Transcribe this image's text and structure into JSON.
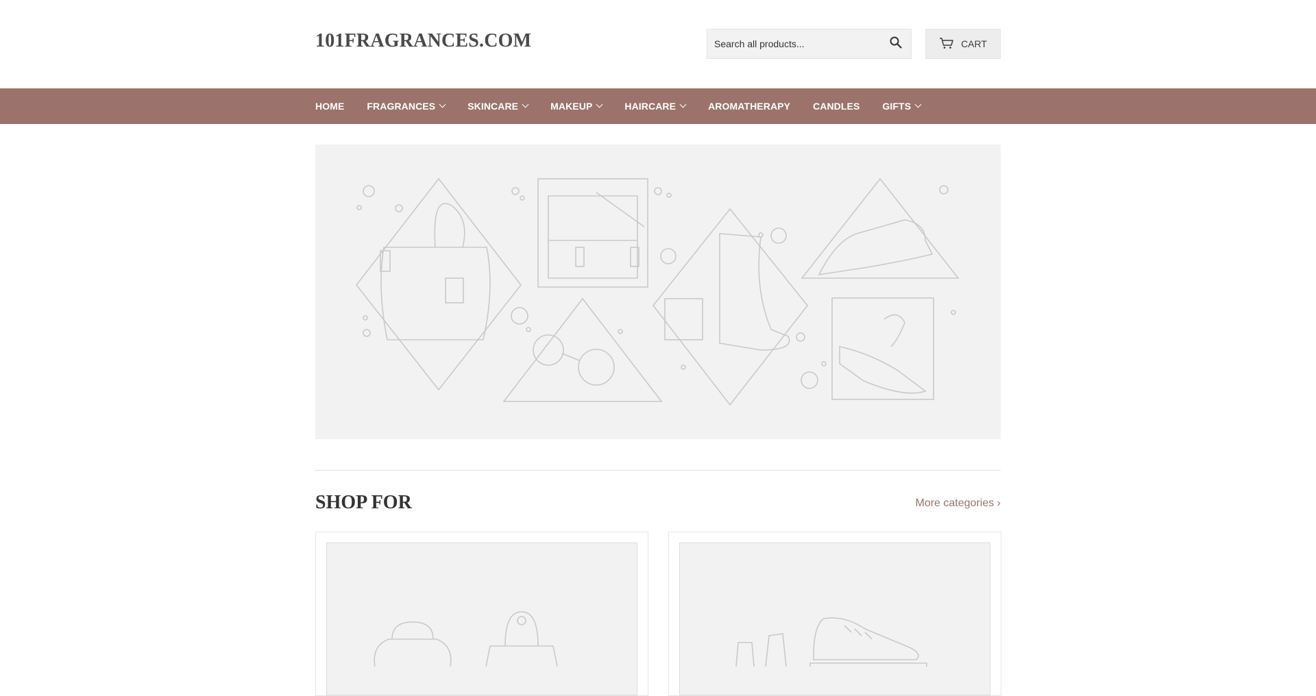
{
  "header": {
    "logo": "101FRAGRANCES.COM",
    "search_placeholder": "Search all products...",
    "cart_label": "CART"
  },
  "nav": {
    "items": [
      {
        "label": "HOME",
        "has_dropdown": false
      },
      {
        "label": "FRAGRANCES",
        "has_dropdown": true
      },
      {
        "label": "SKINCARE",
        "has_dropdown": true
      },
      {
        "label": "MAKEUP",
        "has_dropdown": true
      },
      {
        "label": "HAIRCARE",
        "has_dropdown": true
      },
      {
        "label": "AROMATHERAPY",
        "has_dropdown": false
      },
      {
        "label": "CANDLES",
        "has_dropdown": false
      },
      {
        "label": "GIFTS",
        "has_dropdown": true
      }
    ]
  },
  "shop": {
    "title": "SHOP FOR",
    "more_link": "More categories ›"
  },
  "icons": [
    "search-icon",
    "cart-icon",
    "chevron-down-icon"
  ],
  "colors": {
    "nav_bg": "#9b736b",
    "accent": "#9b736b",
    "placeholder_bg": "#f2f2f2"
  }
}
